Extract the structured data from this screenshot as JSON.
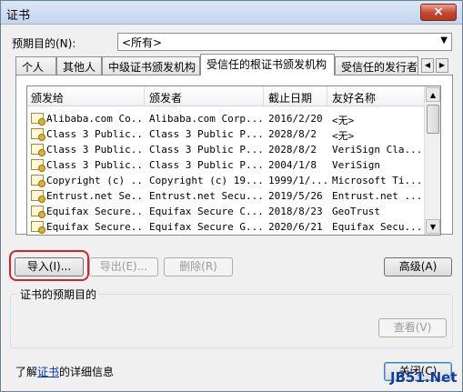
{
  "window": {
    "title": "证书",
    "close_icon": "×"
  },
  "purpose": {
    "label": "预期目的(N):",
    "value": "<所有>"
  },
  "tabs": [
    {
      "label": "个人",
      "active": false
    },
    {
      "label": "其他人",
      "active": false
    },
    {
      "label": "中级证书颁发机构",
      "active": false
    },
    {
      "label": "受信任的根证书颁发机构",
      "active": true
    },
    {
      "label": "受信任的发行者",
      "active": false
    }
  ],
  "tab_scroll": {
    "left": "◀",
    "right": "▶"
  },
  "list": {
    "columns": [
      "颁发给",
      "颁发者",
      "截止日期",
      "友好名称"
    ],
    "rows": [
      {
        "issued_to": "Alibaba.com Co...",
        "issued_by": "Alibaba.com Corp...",
        "expires": "2016/2/20",
        "friendly": "<无>"
      },
      {
        "issued_to": "Class 3 Public...",
        "issued_by": "Class 3 Public P...",
        "expires": "2028/8/2",
        "friendly": "<无>"
      },
      {
        "issued_to": "Class 3 Public...",
        "issued_by": "Class 3 Public P...",
        "expires": "2028/8/2",
        "friendly": "VeriSign Cla..."
      },
      {
        "issued_to": "Class 3 Public...",
        "issued_by": "Class 3 Public P...",
        "expires": "2004/1/8",
        "friendly": "VeriSign"
      },
      {
        "issued_to": "Copyright (c) ...",
        "issued_by": "Copyright (c) 19...",
        "expires": "1999/1/...",
        "friendly": "Microsoft Ti..."
      },
      {
        "issued_to": "Entrust.net Se...",
        "issued_by": "Entrust.net Secu...",
        "expires": "2019/5/26",
        "friendly": "Entrust.net ..."
      },
      {
        "issued_to": "Equifax Secure...",
        "issued_by": "Equifax Secure C...",
        "expires": "2018/8/23",
        "friendly": "GeoTrust"
      },
      {
        "issued_to": "Equifax Secure...",
        "issued_by": "Equifax Secure G...",
        "expires": "2020/6/21",
        "friendly": "Equifax Secu..."
      }
    ]
  },
  "buttons": {
    "import": "导入(I)...",
    "export": "导出(E)...",
    "remove": "删除(R)",
    "advanced": "高级(A)",
    "view": "查看(V)",
    "close": "关闭(C)"
  },
  "purpose_group": {
    "label": "证书的预期目的"
  },
  "learn_more": {
    "prefix": "了解",
    "link": "证书",
    "suffix": "的详细信息"
  },
  "watermark": "JB51.Net",
  "colors": {
    "highlight_ring": "#d0262b",
    "link": "#0033cc",
    "title_bar": "#c3d6ee"
  }
}
